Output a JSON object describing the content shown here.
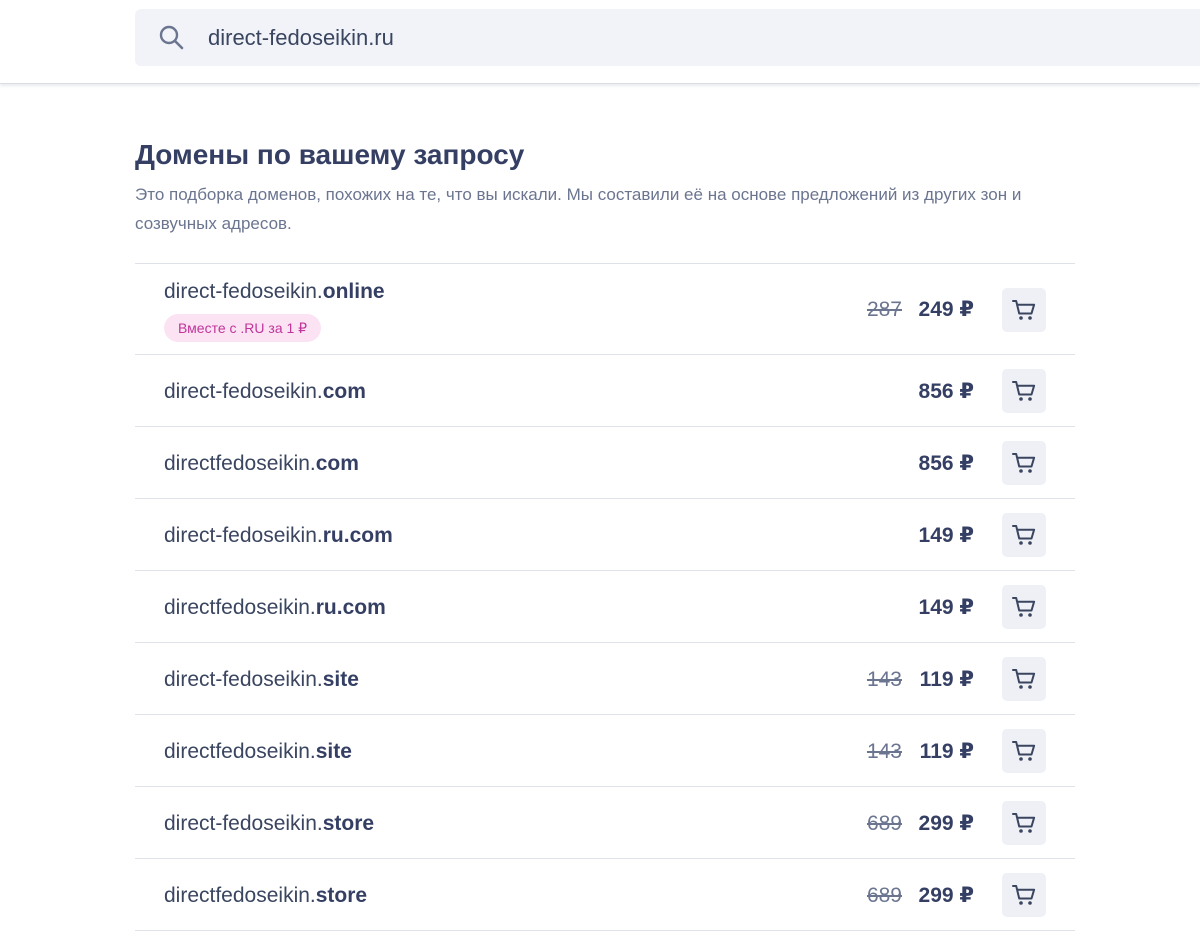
{
  "search": {
    "value": "direct-fedoseikin.ru",
    "icon": "search-icon"
  },
  "section": {
    "title": "Домены по вашему запросу",
    "description": "Это подборка доменов, похожих на те, что вы искали. Мы составили её на основе предложений из других зон и созвучных адресов."
  },
  "domains": [
    {
      "name": "direct-fedoseikin.",
      "zone": "online",
      "badge": "Вместе с .RU за 1 ₽",
      "old_price": "287",
      "price": "249 ₽"
    },
    {
      "name": "direct-fedoseikin.",
      "zone": "com",
      "badge": "",
      "old_price": "",
      "price": "856 ₽"
    },
    {
      "name": "directfedoseikin.",
      "zone": "com",
      "badge": "",
      "old_price": "",
      "price": "856 ₽"
    },
    {
      "name": "direct-fedoseikin.",
      "zone": "ru.com",
      "badge": "",
      "old_price": "",
      "price": "149 ₽"
    },
    {
      "name": "directfedoseikin.",
      "zone": "ru.com",
      "badge": "",
      "old_price": "",
      "price": "149 ₽"
    },
    {
      "name": "direct-fedoseikin.",
      "zone": "site",
      "badge": "",
      "old_price": "143",
      "price": "119 ₽"
    },
    {
      "name": "directfedoseikin.",
      "zone": "site",
      "badge": "",
      "old_price": "143",
      "price": "119 ₽"
    },
    {
      "name": "direct-fedoseikin.",
      "zone": "store",
      "badge": "",
      "old_price": "689",
      "price": "299 ₽"
    },
    {
      "name": "directfedoseikin.",
      "zone": "store",
      "badge": "",
      "old_price": "689",
      "price": "299 ₽"
    }
  ],
  "icons": {
    "cart": "cart-icon"
  },
  "colors": {
    "accent_badge_bg": "#fbe3f3",
    "accent_badge_text": "#c0359a",
    "text_primary": "#343f63",
    "text_secondary": "#6b7590"
  }
}
